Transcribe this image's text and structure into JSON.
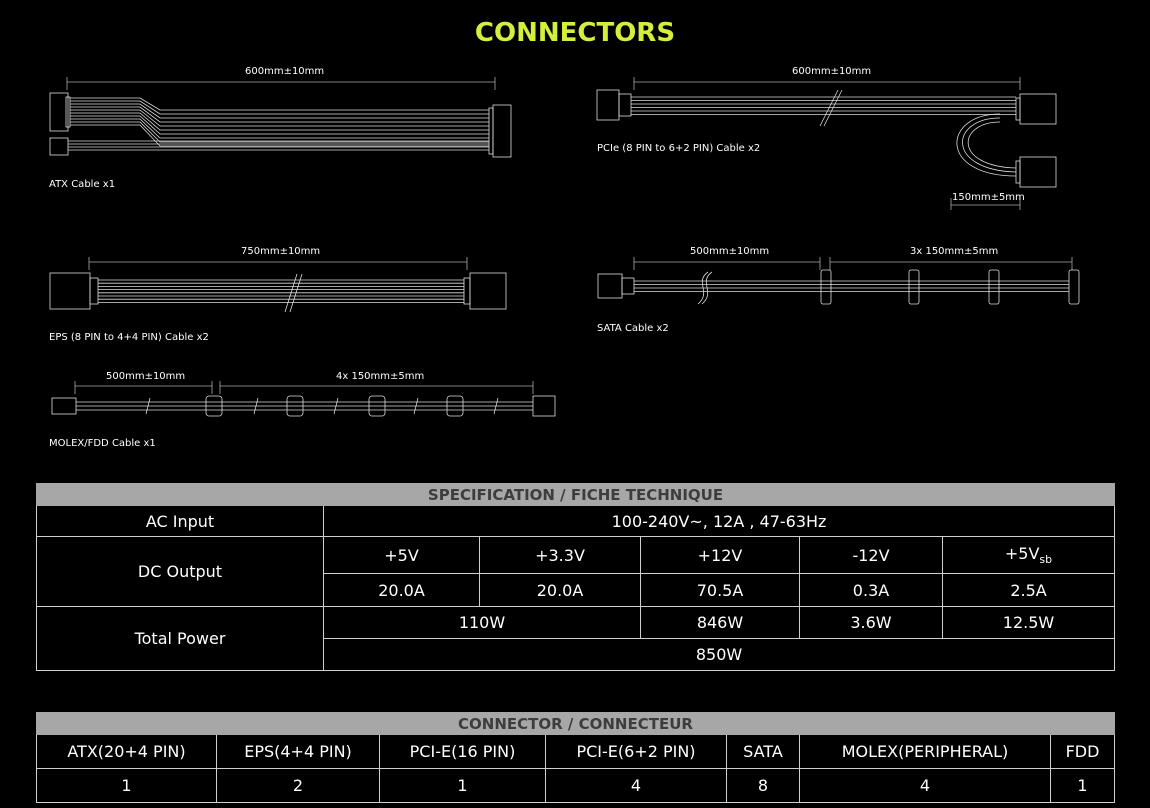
{
  "title": "CONNECTORS",
  "cables": {
    "atx": {
      "label": "ATX Cable x1",
      "length": "600mm±10mm"
    },
    "pcie": {
      "label": "PCIe (8 PIN to 6+2 PIN) Cable x2",
      "length": "600mm±10mm",
      "branch_length": "150mm±5mm"
    },
    "eps": {
      "label": "EPS (8 PIN to 4+4 PIN) Cable x2",
      "length": "750mm±10mm"
    },
    "sata": {
      "label": "SATA Cable x2",
      "length": "500mm±10mm",
      "segment_length": "3x 150mm±5mm"
    },
    "molex": {
      "label": "MOLEX/FDD Cable x1",
      "length": "500mm±10mm",
      "segment_length": "4x 150mm±5mm"
    }
  },
  "spec": {
    "header": "SPECIFICATION / FICHE TECHNIQUE",
    "ac_input_label": "AC Input",
    "ac_input_value": "100-240V~, 12A , 47-63Hz",
    "dc_output_label": "DC Output",
    "rails": [
      "+5V",
      "+3.3V",
      "+12V",
      "-12V",
      "+5V"
    ],
    "rail_subscript": "sb",
    "currents": [
      "20.0A",
      "20.0A",
      "70.5A",
      "0.3A",
      "2.5A"
    ],
    "total_power_label": "Total Power",
    "power_combined_5v_33v": "110W",
    "power_12v": "846W",
    "power_minus12v": "3.6W",
    "power_5vsb": "12.5W",
    "power_total": "850W"
  },
  "connectors": {
    "header": "CONNECTOR / CONNECTEUR",
    "names": [
      "ATX(20+4 PIN)",
      "EPS(4+4 PIN)",
      "PCI-E(16 PIN)",
      "PCI-E(6+2 PIN)",
      "SATA",
      "MOLEX(PERIPHERAL)",
      "FDD"
    ],
    "counts": [
      "1",
      "2",
      "1",
      "4",
      "8",
      "4",
      "1"
    ]
  }
}
